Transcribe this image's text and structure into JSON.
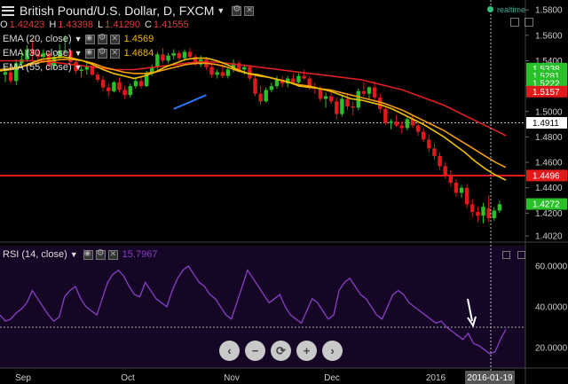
{
  "header": {
    "title": "British Pound/U.S. Dollar, D, FXCM",
    "realtime_label": "realtime",
    "ohlc": [
      {
        "key": "O",
        "value": "1.42423"
      },
      {
        "key": "H",
        "value": "1.43398"
      },
      {
        "key": "L",
        "value": "1.41290"
      },
      {
        "key": "C",
        "value": "1.41555"
      }
    ]
  },
  "indicators": [
    {
      "label": "EMA (20, close)",
      "value": "1.4569",
      "color": "#f0c000"
    },
    {
      "label": "EMA (30, close)",
      "value": "1.4684",
      "color": "#f39c12"
    },
    {
      "label": "EMA (55, close)",
      "value": "",
      "color": "#e02020"
    }
  ],
  "rsi": {
    "label": "RSI (14, close)",
    "value": "15.7967",
    "color": "#8a3fc7"
  },
  "price_axis": {
    "ticks": [
      "1.5800",
      "1.5600",
      "1.5400",
      "1.5200",
      "1.5000",
      "1.4800",
      "1.4600",
      "1.4400",
      "1.4200",
      "1.4020"
    ],
    "markers": [
      {
        "label": "1.5338",
        "color": "#29c029"
      },
      {
        "label": "1.5281",
        "color": "#29c029"
      },
      {
        "label": "1.5222",
        "color": "#29c029"
      },
      {
        "label": "1.5157",
        "color": "#e01a1a"
      },
      {
        "label": "1.4911",
        "color": "#ffffff"
      },
      {
        "label": "1.4496",
        "color": "#e01a1a"
      },
      {
        "label": "1.4272",
        "color": "#29c029"
      }
    ]
  },
  "rsi_axis": {
    "ticks": [
      "60.0000",
      "40.0000",
      "20.0000"
    ]
  },
  "time_axis": {
    "ticks": [
      "Sep",
      "Oct",
      "Nov",
      "Dec",
      "2016"
    ],
    "cursor_label": "2016-01-19"
  },
  "chart_data": {
    "type": "candlestick",
    "ylim": [
      1.4,
      1.585
    ],
    "horizontal_levels": [
      1.4911,
      1.4496
    ],
    "candles": [
      [
        1.529,
        1.536,
        1.523,
        1.531
      ],
      [
        1.531,
        1.535,
        1.522,
        1.524
      ],
      [
        1.524,
        1.541,
        1.521,
        1.538
      ],
      [
        1.538,
        1.545,
        1.535,
        1.541
      ],
      [
        1.541,
        1.552,
        1.539,
        1.549
      ],
      [
        1.549,
        1.558,
        1.54,
        1.545
      ],
      [
        1.545,
        1.549,
        1.538,
        1.543
      ],
      [
        1.543,
        1.549,
        1.542,
        1.546
      ],
      [
        1.546,
        1.548,
        1.533,
        1.536
      ],
      [
        1.536,
        1.546,
        1.533,
        1.543
      ],
      [
        1.543,
        1.553,
        1.541,
        1.548
      ],
      [
        1.548,
        1.56,
        1.546,
        1.548
      ],
      [
        1.548,
        1.55,
        1.538,
        1.539
      ],
      [
        1.539,
        1.542,
        1.53,
        1.532
      ],
      [
        1.532,
        1.536,
        1.527,
        1.533
      ],
      [
        1.533,
        1.54,
        1.529,
        1.536
      ],
      [
        1.536,
        1.538,
        1.528,
        1.529
      ],
      [
        1.529,
        1.531,
        1.523,
        1.525
      ],
      [
        1.525,
        1.528,
        1.516,
        1.519
      ],
      [
        1.519,
        1.522,
        1.512,
        1.516
      ],
      [
        1.516,
        1.524,
        1.515,
        1.523
      ],
      [
        1.523,
        1.527,
        1.515,
        1.517
      ],
      [
        1.517,
        1.52,
        1.51,
        1.513
      ],
      [
        1.513,
        1.522,
        1.511,
        1.52
      ],
      [
        1.52,
        1.527,
        1.518,
        1.524
      ],
      [
        1.524,
        1.528,
        1.518,
        1.52
      ],
      [
        1.52,
        1.532,
        1.519,
        1.53
      ],
      [
        1.53,
        1.537,
        1.528,
        1.535
      ],
      [
        1.535,
        1.547,
        1.533,
        1.545
      ],
      [
        1.545,
        1.55,
        1.538,
        1.54
      ],
      [
        1.54,
        1.546,
        1.538,
        1.544
      ],
      [
        1.544,
        1.549,
        1.541,
        1.546
      ],
      [
        1.546,
        1.548,
        1.54,
        1.542
      ],
      [
        1.542,
        1.549,
        1.54,
        1.547
      ],
      [
        1.547,
        1.55,
        1.541,
        1.543
      ],
      [
        1.543,
        1.545,
        1.536,
        1.537
      ],
      [
        1.537,
        1.544,
        1.535,
        1.541
      ],
      [
        1.541,
        1.543,
        1.533,
        1.535
      ],
      [
        1.535,
        1.538,
        1.527,
        1.529
      ],
      [
        1.529,
        1.533,
        1.526,
        1.531
      ],
      [
        1.531,
        1.537,
        1.526,
        1.528
      ],
      [
        1.528,
        1.535,
        1.526,
        1.533
      ],
      [
        1.533,
        1.541,
        1.531,
        1.538
      ],
      [
        1.538,
        1.54,
        1.531,
        1.533
      ],
      [
        1.533,
        1.537,
        1.529,
        1.535
      ],
      [
        1.535,
        1.537,
        1.524,
        1.526
      ],
      [
        1.526,
        1.528,
        1.512,
        1.514
      ],
      [
        1.514,
        1.52,
        1.505,
        1.508
      ],
      [
        1.508,
        1.519,
        1.507,
        1.517
      ],
      [
        1.517,
        1.523,
        1.515,
        1.52
      ],
      [
        1.52,
        1.528,
        1.518,
        1.525
      ],
      [
        1.525,
        1.528,
        1.519,
        1.522
      ],
      [
        1.522,
        1.528,
        1.519,
        1.526
      ],
      [
        1.526,
        1.53,
        1.521,
        1.523
      ],
      [
        1.523,
        1.53,
        1.522,
        1.528
      ],
      [
        1.528,
        1.533,
        1.525,
        1.526
      ],
      [
        1.526,
        1.528,
        1.517,
        1.519
      ],
      [
        1.519,
        1.523,
        1.514,
        1.518
      ],
      [
        1.518,
        1.52,
        1.508,
        1.51
      ],
      [
        1.51,
        1.515,
        1.503,
        1.512
      ],
      [
        1.512,
        1.517,
        1.506,
        1.508
      ],
      [
        1.508,
        1.511,
        1.494,
        1.498
      ],
      [
        1.498,
        1.512,
        1.496,
        1.51
      ],
      [
        1.51,
        1.514,
        1.501,
        1.504
      ],
      [
        1.504,
        1.508,
        1.497,
        1.503
      ],
      [
        1.503,
        1.518,
        1.501,
        1.516
      ],
      [
        1.516,
        1.523,
        1.512,
        1.514
      ],
      [
        1.514,
        1.52,
        1.51,
        1.519
      ],
      [
        1.519,
        1.524,
        1.509,
        1.511
      ],
      [
        1.511,
        1.514,
        1.499,
        1.502
      ],
      [
        1.502,
        1.504,
        1.489,
        1.491
      ],
      [
        1.491,
        1.494,
        1.486,
        1.492
      ],
      [
        1.492,
        1.497,
        1.488,
        1.489
      ],
      [
        1.489,
        1.492,
        1.483,
        1.487
      ],
      [
        1.487,
        1.496,
        1.485,
        1.494
      ],
      [
        1.494,
        1.497,
        1.487,
        1.489
      ],
      [
        1.489,
        1.491,
        1.481,
        1.484
      ],
      [
        1.484,
        1.487,
        1.476,
        1.478
      ],
      [
        1.478,
        1.482,
        1.468,
        1.471
      ],
      [
        1.471,
        1.475,
        1.462,
        1.465
      ],
      [
        1.465,
        1.468,
        1.454,
        1.457
      ],
      [
        1.457,
        1.46,
        1.447,
        1.45
      ],
      [
        1.45,
        1.454,
        1.441,
        1.444
      ],
      [
        1.444,
        1.447,
        1.433,
        1.436
      ],
      [
        1.436,
        1.442,
        1.432,
        1.44
      ],
      [
        1.44,
        1.443,
        1.424,
        1.427
      ],
      [
        1.427,
        1.431,
        1.417,
        1.421
      ],
      [
        1.421,
        1.425,
        1.413,
        1.418
      ],
      [
        1.418,
        1.428,
        1.412,
        1.425
      ],
      [
        1.424,
        1.434,
        1.413,
        1.416
      ],
      [
        1.416,
        1.425,
        1.414,
        1.422
      ],
      [
        1.422,
        1.43,
        1.42,
        1.427
      ]
    ],
    "ema20": [
      1.532,
      1.533,
      1.535,
      1.538,
      1.541,
      1.542,
      1.543,
      1.542,
      1.54,
      1.537,
      1.533,
      1.53,
      1.528,
      1.526,
      1.528,
      1.531,
      1.535,
      1.538,
      1.541,
      1.542,
      1.542,
      1.54,
      1.537,
      1.533,
      1.53,
      1.529,
      1.527,
      1.525,
      1.523,
      1.52,
      1.519,
      1.518,
      1.516,
      1.513,
      1.51,
      1.509,
      1.507,
      1.505,
      1.502,
      1.498,
      1.494,
      1.49,
      1.485,
      1.48,
      1.474,
      1.468,
      1.461,
      1.455,
      1.45,
      1.446
    ],
    "ema30": [
      1.533,
      1.534,
      1.535,
      1.537,
      1.539,
      1.54,
      1.541,
      1.541,
      1.54,
      1.538,
      1.535,
      1.533,
      1.531,
      1.53,
      1.53,
      1.531,
      1.533,
      1.535,
      1.537,
      1.538,
      1.538,
      1.537,
      1.535,
      1.532,
      1.53,
      1.528,
      1.527,
      1.525,
      1.523,
      1.521,
      1.52,
      1.518,
      1.517,
      1.515,
      1.513,
      1.511,
      1.509,
      1.507,
      1.504,
      1.501,
      1.497,
      1.493,
      1.489,
      1.485,
      1.48,
      1.475,
      1.47,
      1.465,
      1.46,
      1.456
    ],
    "ema55": [
      1.54,
      1.54,
      1.54,
      1.54,
      1.54,
      1.539,
      1.538,
      1.537,
      1.536,
      1.535,
      1.534,
      1.533,
      1.533,
      1.533,
      1.534,
      1.535,
      1.536,
      1.537,
      1.538,
      1.539,
      1.539,
      1.539,
      1.538,
      1.537,
      1.536,
      1.535,
      1.534,
      1.533,
      1.532,
      1.531,
      1.53,
      1.529,
      1.528,
      1.527,
      1.526,
      1.525,
      1.523,
      1.521,
      1.519,
      1.517,
      1.514,
      1.511,
      1.508,
      1.505,
      1.501,
      1.497,
      1.493,
      1.489,
      1.485,
      1.481
    ],
    "trendline": [
      [
        31,
        1.502
      ],
      [
        37,
        1.513
      ]
    ],
    "rsi_values": [
      36,
      33,
      34,
      37,
      39,
      42,
      48,
      44,
      40,
      36,
      33,
      35,
      45,
      48,
      50,
      44,
      40,
      38,
      36,
      44,
      52,
      56,
      58,
      55,
      50,
      46,
      45,
      52,
      48,
      44,
      42,
      40,
      48,
      54,
      58,
      60,
      56,
      52,
      50,
      46,
      44,
      40,
      36,
      34,
      42,
      50,
      58,
      54,
      50,
      46,
      42,
      44,
      46,
      40,
      36,
      34,
      32,
      38,
      44,
      42,
      38,
      34,
      36,
      48,
      52,
      54,
      50,
      46,
      44,
      40,
      36,
      34,
      40,
      46,
      48,
      46,
      42,
      40,
      38,
      36,
      34,
      32,
      33,
      30,
      28,
      26,
      24,
      27,
      22,
      21,
      19,
      17,
      18,
      24,
      29
    ]
  },
  "nav": [
    "‹",
    "−",
    "⟳",
    "+",
    "›"
  ]
}
